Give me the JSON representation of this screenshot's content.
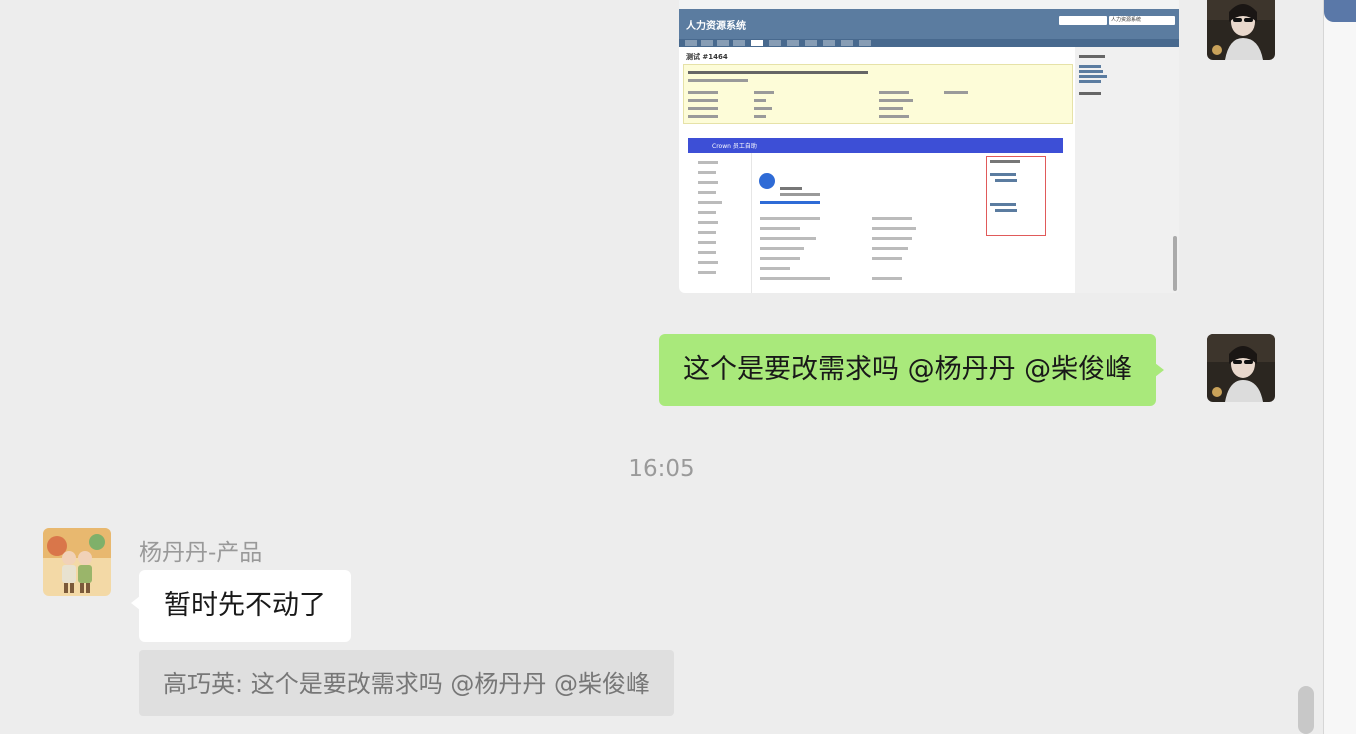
{
  "messages": {
    "outgoing_text": "这个是要改需求吗 @杨丹丹  @柴俊峰",
    "timestamp": "16:05",
    "incoming_sender": "杨丹丹-产品",
    "incoming_text": "暂时先不动了",
    "quote_text": "高巧英: 这个是要改需求吗 @杨丹丹  @柴俊峰"
  },
  "screenshot_image": {
    "system_title": "人力资源系统",
    "issue_title": "测试 #1464",
    "project_select": "人力资源系统",
    "app_name": "Crown 员工自助"
  },
  "colors": {
    "outgoing_bubble": "#a9e97b",
    "incoming_bubble": "#ffffff",
    "chat_background": "#ededed",
    "quote_background": "#dfdfdf"
  },
  "icons": [
    "user-avatar-icon",
    "sender-avatar-icon",
    "screenshot-thumbnail"
  ]
}
